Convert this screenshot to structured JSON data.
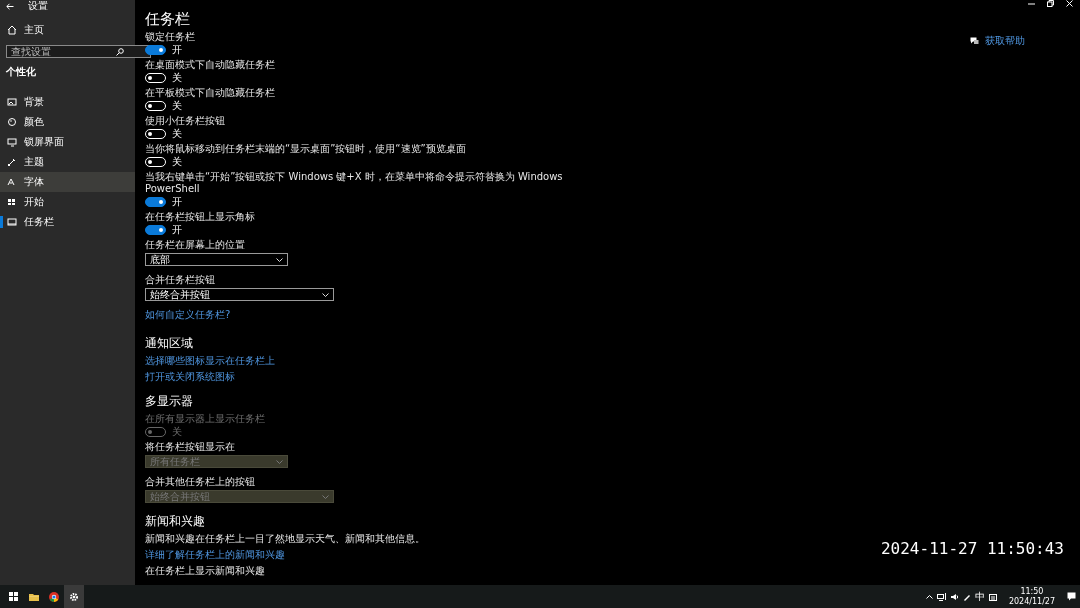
{
  "window": {
    "title": "设置"
  },
  "sidebar": {
    "home": "主页",
    "search": {
      "placeholder": "查找设置"
    },
    "section": "个性化",
    "items": [
      {
        "label": "背景",
        "selected": false,
        "hovered": false
      },
      {
        "label": "颜色",
        "selected": false,
        "hovered": false
      },
      {
        "label": "锁屏界面",
        "selected": false,
        "hovered": false
      },
      {
        "label": "主题",
        "selected": false,
        "hovered": false
      },
      {
        "label": "字体",
        "selected": false,
        "hovered": true
      },
      {
        "label": "开始",
        "selected": false,
        "hovered": false
      },
      {
        "label": "任务栏",
        "selected": true,
        "hovered": false
      }
    ]
  },
  "page": {
    "title": "任务栏",
    "help_link": "获取帮助",
    "sections": [
      {
        "items": [
          {
            "kind": "toggle",
            "label": "锁定任务栏",
            "on": true,
            "state_label": "开",
            "disabled": false
          },
          {
            "kind": "toggle",
            "label": "在桌面模式下自动隐藏任务栏",
            "on": false,
            "state_label": "关",
            "disabled": false
          },
          {
            "kind": "toggle",
            "label": "在平板模式下自动隐藏任务栏",
            "on": false,
            "state_label": "关",
            "disabled": false
          },
          {
            "kind": "toggle",
            "label": "使用小任务栏按钮",
            "on": false,
            "state_label": "关",
            "disabled": false
          },
          {
            "kind": "toggle",
            "label": "当你将鼠标移动到任务栏末端的“显示桌面”按钮时，使用“速览”预览桌面",
            "on": false,
            "state_label": "关",
            "disabled": false
          },
          {
            "kind": "toggle",
            "label": "当我右键单击“开始”按钮或按下 Windows 键+X 时，在菜单中将命令提示符替换为 Windows PowerShell",
            "on": true,
            "state_label": "开",
            "disabled": false
          },
          {
            "kind": "toggle",
            "label": "在任务栏按钮上显示角标",
            "on": true,
            "state_label": "开",
            "disabled": false
          },
          {
            "kind": "dropdown",
            "label": "任务栏在屏幕上的位置",
            "value": "底部",
            "disabled": false
          },
          {
            "kind": "dropdown",
            "label": "合并任务栏按钮",
            "value": "始终合并按钮",
            "disabled": false
          },
          {
            "kind": "link",
            "text": "如何自定义任务栏?"
          }
        ]
      },
      {
        "heading": "通知区域",
        "items": [
          {
            "kind": "link",
            "text": "选择哪些图标显示在任务栏上"
          },
          {
            "kind": "link",
            "text": "打开或关闭系统图标"
          }
        ]
      },
      {
        "heading": "多显示器",
        "items": [
          {
            "kind": "toggle",
            "label": "在所有显示器上显示任务栏",
            "on": false,
            "state_label": "关",
            "disabled": true
          },
          {
            "kind": "dropdown",
            "label": "将任务栏按钮显示在",
            "value": "所有任务栏",
            "disabled": true
          },
          {
            "kind": "dropdown",
            "label": "合并其他任务栏上的按钮",
            "value": "始终合并按钮",
            "disabled": true
          }
        ]
      },
      {
        "heading": "新闻和兴趣",
        "items": [
          {
            "kind": "text",
            "text": "新闻和兴趣在任务栏上一目了然地显示天气、新闻和其他信息。"
          },
          {
            "kind": "link",
            "text": "详细了解任务栏上的新闻和兴趣"
          },
          {
            "kind": "text",
            "text": "在任务栏上显示新闻和兴趣"
          }
        ]
      }
    ]
  },
  "timestamp_overlay": "2024-11-27 11:50:43",
  "taskbar": {
    "ime": "中",
    "time": "11:50",
    "date": "2024/11/27"
  }
}
